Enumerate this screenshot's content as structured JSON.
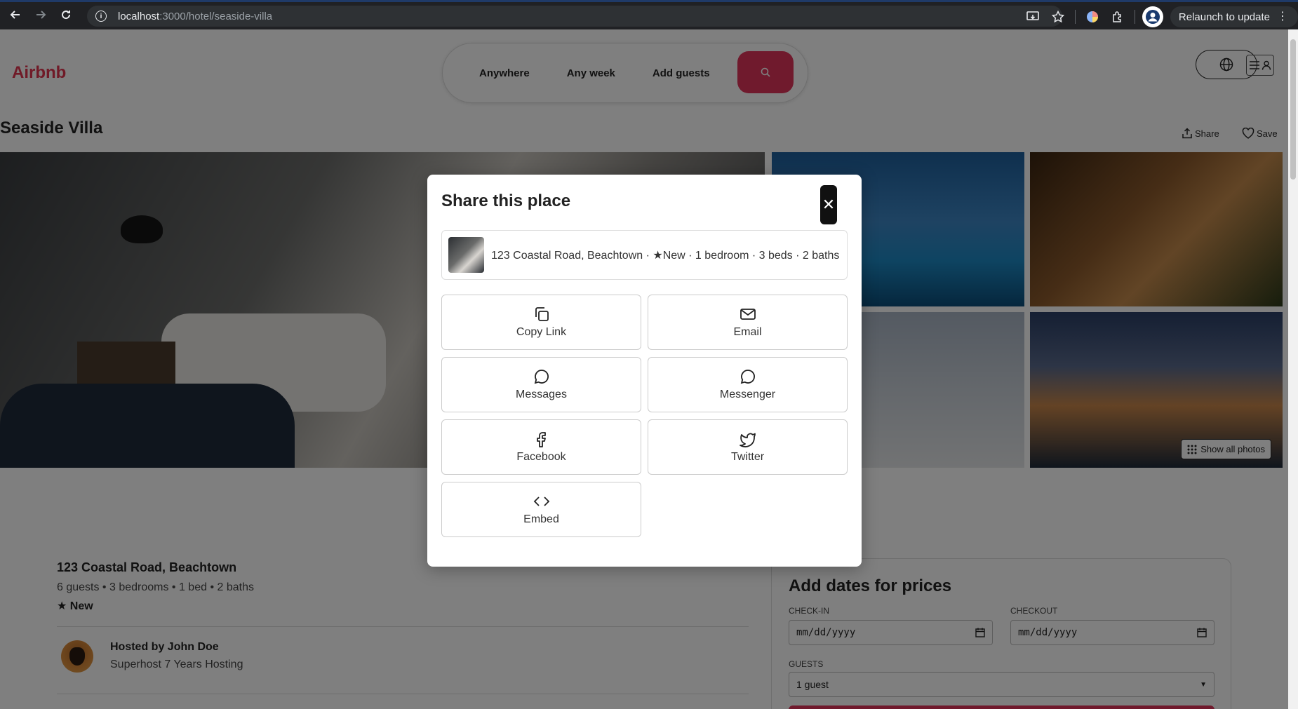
{
  "browser": {
    "url_host": "localhost",
    "url_path": ":3000/hotel/seaside-villa",
    "relaunch_label": "Relaunch to update"
  },
  "header": {
    "logo": "Airbnb",
    "search": {
      "where": "Anywhere",
      "when": "Any week",
      "who": "Add guests"
    }
  },
  "listing": {
    "title": "Seaside Villa",
    "share_label": "Share",
    "save_label": "Save",
    "show_all_photos": "Show all photos",
    "address": "123 Coastal Road, Beachtown",
    "details": "6 guests • 3 bedrooms • 1 bed • 2 baths",
    "badge": "★ New",
    "host_name": "Hosted by John Doe",
    "host_sub": "Superhost 7 Years Hosting"
  },
  "booking": {
    "title": "Add dates for prices",
    "checkin_label": "CHECK-IN",
    "checkout_label": "CHECKOUT",
    "checkin_value": "mm/dd/yyyy",
    "checkout_value": "mm/dd/yyyy",
    "guests_label": "GUESTS",
    "guests_value": "1 guest"
  },
  "modal": {
    "title": "Share this place",
    "close_glyph": "✕",
    "listing_summary": "123 Coastal Road, Beachtown · ★New · 1 bedroom · 3 beds · 2 baths",
    "options": [
      {
        "label": "Copy Link",
        "icon": "copy-icon"
      },
      {
        "label": "Email",
        "icon": "mail-icon"
      },
      {
        "label": "Messages",
        "icon": "chat-bubble-icon"
      },
      {
        "label": "Messenger",
        "icon": "chat-bubble-icon"
      },
      {
        "label": "Facebook",
        "icon": "facebook-icon"
      },
      {
        "label": "Twitter",
        "icon": "twitter-icon"
      },
      {
        "label": "Embed",
        "icon": "code-icon"
      }
    ]
  },
  "colors": {
    "brand": "#e0344f",
    "search_button": "#e0345a",
    "chrome_bg": "#202124"
  }
}
